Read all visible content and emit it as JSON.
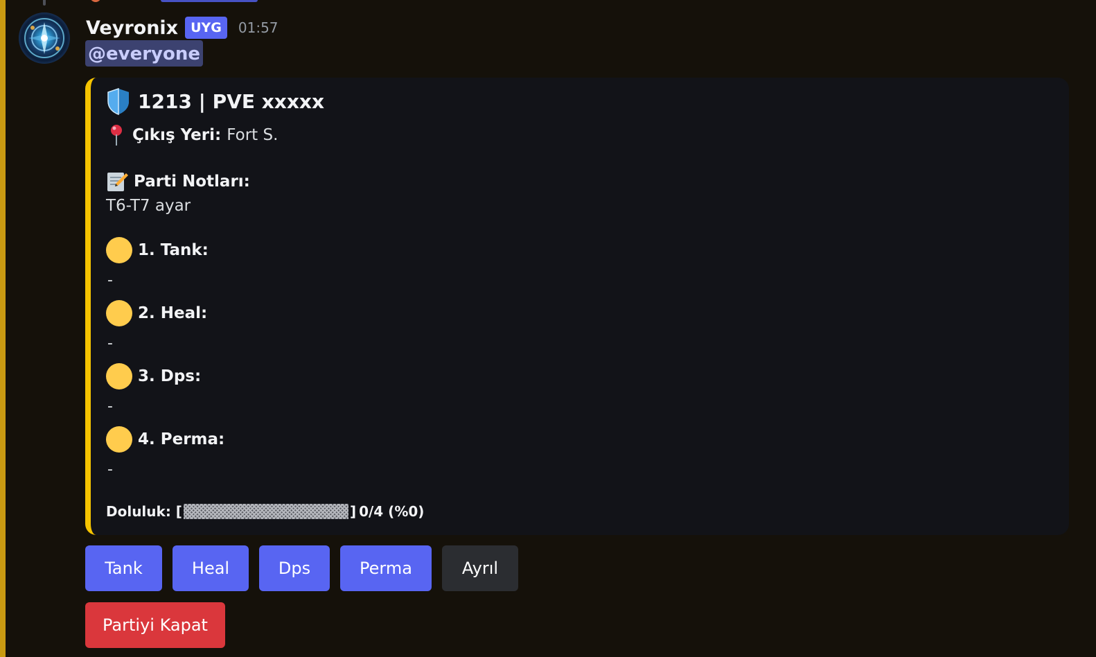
{
  "message": {
    "author": "Veyronix",
    "role_tag": "UYG",
    "timestamp": "01:57",
    "mention": "@everyone"
  },
  "embed": {
    "accent_color": "#f6c400",
    "title_icon": "shield-icon",
    "title": "1213 | PVE xxxxx",
    "location_icon": "pushpin-icon",
    "location_label": "Çıkış Yeri:",
    "location_value": "Fort S.",
    "notes_icon": "memo-icon",
    "notes_label": "Parti Notları:",
    "notes_value": "T6-T7 ayar",
    "slots": [
      {
        "icon": "yellow-circle-icon",
        "label": "1. Tank:",
        "value": "-"
      },
      {
        "icon": "yellow-circle-icon",
        "label": "2. Heal:",
        "value": "-"
      },
      {
        "icon": "yellow-circle-icon",
        "label": "3. Dps:",
        "value": "-"
      },
      {
        "icon": "yellow-circle-icon",
        "label": "4. Perma:",
        "value": "-"
      }
    ],
    "fill": {
      "label": "Doluluk: [",
      "close": "]",
      "summary": "0/4 (%0)",
      "filled": 0,
      "total": 4
    }
  },
  "buttons": {
    "tank": "Tank",
    "heal": "Heal",
    "dps": "Dps",
    "perma": "Perma",
    "leave": "Ayrıl",
    "close_party": "Partiyi Kapat"
  },
  "colors": {
    "background": "#15110a",
    "embed_bg": "#121318",
    "primary_button": "#5865f2",
    "secondary_button": "#2b2d31",
    "danger_button": "#da373c",
    "slot_circle": "#ffcc4d"
  }
}
